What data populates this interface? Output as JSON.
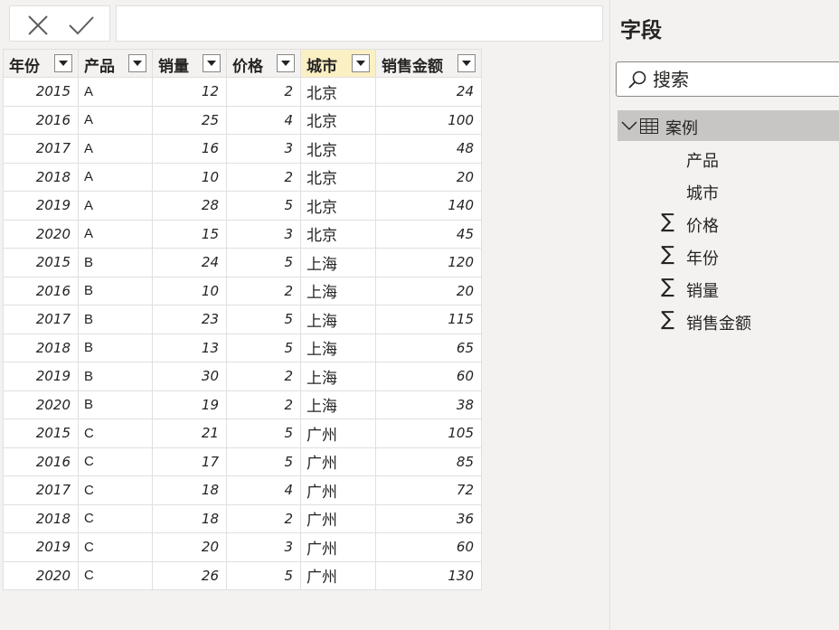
{
  "formula_bar": {
    "cancel_icon": "close-icon",
    "commit_icon": "checkmark-icon",
    "value": ""
  },
  "table": {
    "columns": [
      {
        "label": "年份"
      },
      {
        "label": "产品"
      },
      {
        "label": "销量"
      },
      {
        "label": "价格"
      },
      {
        "label": "城市",
        "selected": true
      },
      {
        "label": "销售金额"
      }
    ],
    "rows": [
      [
        "2015",
        "A",
        "12",
        "2",
        "北京",
        "24"
      ],
      [
        "2016",
        "A",
        "25",
        "4",
        "北京",
        "100"
      ],
      [
        "2017",
        "A",
        "16",
        "3",
        "北京",
        "48"
      ],
      [
        "2018",
        "A",
        "10",
        "2",
        "北京",
        "20"
      ],
      [
        "2019",
        "A",
        "28",
        "5",
        "北京",
        "140"
      ],
      [
        "2020",
        "A",
        "15",
        "3",
        "北京",
        "45"
      ],
      [
        "2015",
        "B",
        "24",
        "5",
        "上海",
        "120"
      ],
      [
        "2016",
        "B",
        "10",
        "2",
        "上海",
        "20"
      ],
      [
        "2017",
        "B",
        "23",
        "5",
        "上海",
        "115"
      ],
      [
        "2018",
        "B",
        "13",
        "5",
        "上海",
        "65"
      ],
      [
        "2019",
        "B",
        "30",
        "2",
        "上海",
        "60"
      ],
      [
        "2020",
        "B",
        "19",
        "2",
        "上海",
        "38"
      ],
      [
        "2015",
        "C",
        "21",
        "5",
        "广州",
        "105"
      ],
      [
        "2016",
        "C",
        "17",
        "5",
        "广州",
        "85"
      ],
      [
        "2017",
        "C",
        "18",
        "4",
        "广州",
        "72"
      ],
      [
        "2018",
        "C",
        "18",
        "2",
        "广州",
        "36"
      ],
      [
        "2019",
        "C",
        "20",
        "3",
        "广州",
        "60"
      ],
      [
        "2020",
        "C",
        "26",
        "5",
        "广州",
        "130"
      ]
    ]
  },
  "fields_pane": {
    "title": "字段",
    "search_placeholder": "搜索",
    "table_name": "案例",
    "fields": [
      {
        "label": "产品",
        "sigma": false
      },
      {
        "label": "城市",
        "sigma": false
      },
      {
        "label": "价格",
        "sigma": true
      },
      {
        "label": "年份",
        "sigma": true
      },
      {
        "label": "销量",
        "sigma": true
      },
      {
        "label": "销售金额",
        "sigma": true
      }
    ]
  }
}
